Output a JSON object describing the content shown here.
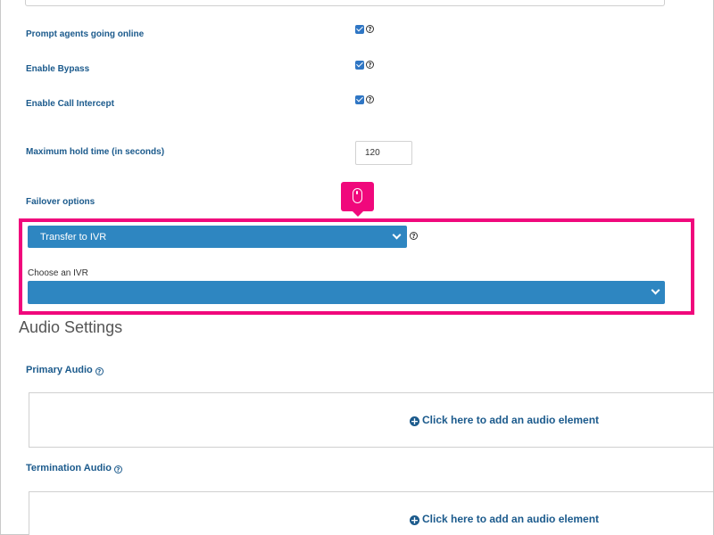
{
  "settings": {
    "prompt_agents_label": "Prompt agents going online",
    "prompt_agents_checked": true,
    "enable_bypass_label": "Enable Bypass",
    "enable_bypass_checked": true,
    "enable_call_intercept_label": "Enable Call Intercept",
    "enable_call_intercept_checked": true,
    "max_hold_time_label": "Maximum hold time (in seconds)",
    "max_hold_time_value": "120",
    "failover_label": "Failover options",
    "failover_selected": "Transfer to IVR",
    "choose_ivr_label": "Choose an IVR",
    "choose_ivr_selected": ""
  },
  "audio": {
    "section_title": "Audio Settings",
    "primary_label": "Primary Audio",
    "primary_add_text": "Click here to add an audio element",
    "termination_label": "Termination Audio",
    "termination_add_text": "Click here to add an audio element"
  },
  "help_glyph": "?",
  "plus_glyph": "+",
  "colors": {
    "accent": "#2e86c1",
    "label_blue": "#1b5a8c",
    "highlight": "#f0087c",
    "checkbox": "#2f76c4"
  },
  "icons": {
    "checkbox": "checkbox-checked-icon",
    "help": "question-circle-icon",
    "mouse": "mouse-icon",
    "chevron": "chevron-down-icon",
    "plus": "plus-circle-icon"
  }
}
